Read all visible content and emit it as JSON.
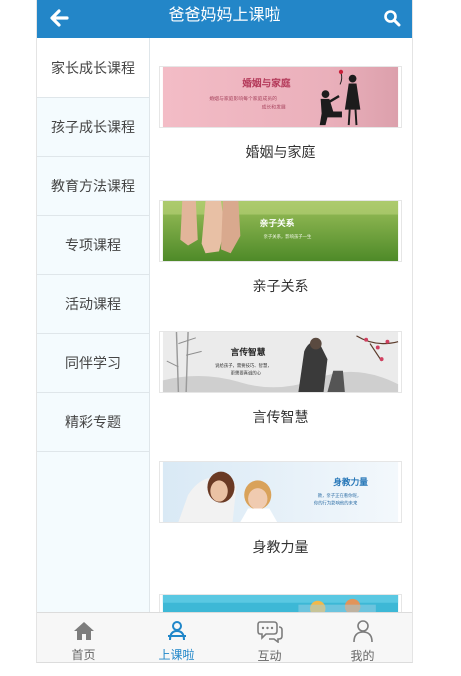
{
  "header": {
    "title": "爸爸妈妈上课啦",
    "back_icon": "back-arrow-icon",
    "search_icon": "search-icon",
    "bg_color": "#2386c8"
  },
  "sidebar": {
    "items": [
      {
        "label": "家长成长课程",
        "active": true
      },
      {
        "label": "孩子成长课程"
      },
      {
        "label": "教育方法课程"
      },
      {
        "label": "专项课程"
      },
      {
        "label": "活动课程"
      },
      {
        "label": "同伴学习"
      },
      {
        "label": "精彩专题"
      }
    ]
  },
  "courses": [
    {
      "caption": "婚姻与家庭",
      "banner_title": "婚姻与家庭",
      "banner_sub1": "婚姻与家庭影响每个家庭成员的",
      "banner_sub2": "成长和发展"
    },
    {
      "caption": "亲子关系",
      "banner_title": "亲子关系",
      "banner_sub1": "亲子关系，影响孩子一生"
    },
    {
      "caption": "言传智慧",
      "banner_title": "言传智慧",
      "banner_sub1": "说给孩子，需要技巧、智慧，",
      "banner_sub2": "更需要真诚的心"
    },
    {
      "caption": "身教力量",
      "banner_title": "身教力量",
      "banner_sub1": "教，亲子正在看你呢，",
      "banner_sub2": "你的行为影响他的未来"
    }
  ],
  "tabbar": {
    "tabs": [
      {
        "label": "首页",
        "icon": "home-icon"
      },
      {
        "label": "上课啦",
        "icon": "class-icon",
        "active": true
      },
      {
        "label": "互动",
        "icon": "chat-icon"
      },
      {
        "label": "我的",
        "icon": "user-icon"
      }
    ],
    "active_color": "#1f86c9"
  }
}
